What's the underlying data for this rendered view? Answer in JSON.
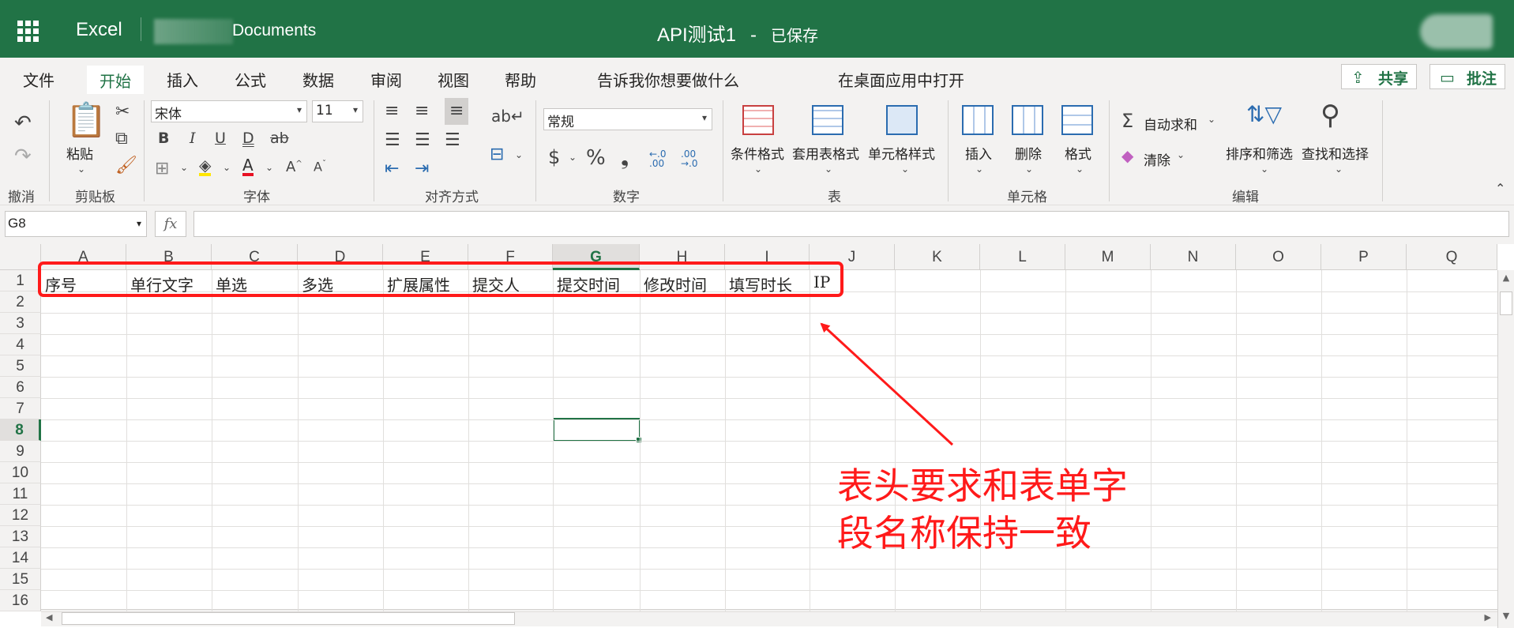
{
  "titlebar": {
    "app_name": "Excel",
    "breadcrumb": "Documents",
    "doc_title": "API测试1",
    "separator": "-",
    "save_status": "已保存"
  },
  "ribbon_tabs": [
    {
      "label": "文件",
      "active": false
    },
    {
      "label": "开始",
      "active": true
    },
    {
      "label": "插入",
      "active": false
    },
    {
      "label": "公式",
      "active": false
    },
    {
      "label": "数据",
      "active": false
    },
    {
      "label": "审阅",
      "active": false
    },
    {
      "label": "视图",
      "active": false
    },
    {
      "label": "帮助",
      "active": false
    },
    {
      "label": "告诉我你想要做什么",
      "active": false
    },
    {
      "label": "在桌面应用中打开",
      "active": false
    }
  ],
  "share_label": "共享",
  "comment_label": "批注",
  "ribbon": {
    "undo_group": "撤消",
    "clipboard": {
      "paste": "粘贴",
      "group": "剪贴板"
    },
    "font": {
      "name": "宋体",
      "size": "11",
      "group": "字体",
      "bold": "B",
      "italic": "I",
      "underline": "U",
      "double_underline": "D",
      "strike": "ab",
      "grow": "A",
      "shrink": "A"
    },
    "alignment": {
      "group": "对齐方式"
    },
    "number": {
      "format": "常规",
      "group": "数字",
      "currency": "$",
      "percent": "%",
      "comma": "❟",
      "inc_decimal": "←.0 .00",
      "dec_decimal": ".00 →.0"
    },
    "styles": {
      "conditional": "条件格式",
      "table_format": "套用表格式",
      "cell_styles": "单元格样式",
      "group": "表"
    },
    "cells": {
      "insert": "插入",
      "delete": "删除",
      "format": "格式",
      "group": "单元格"
    },
    "editing": {
      "autosum": "自动求和",
      "clear": "清除",
      "sort_filter": "排序和筛选",
      "find_select": "查找和选择",
      "group": "编辑"
    }
  },
  "formula_bar": {
    "name_box": "G8",
    "fx": "fx",
    "value": ""
  },
  "sheet": {
    "columns": [
      "A",
      "B",
      "C",
      "D",
      "E",
      "F",
      "G",
      "H",
      "I",
      "J",
      "K",
      "L",
      "M",
      "N",
      "O",
      "P",
      "Q"
    ],
    "rows": [
      "1",
      "2",
      "3",
      "4",
      "5",
      "6",
      "7",
      "8",
      "9",
      "10",
      "11",
      "12",
      "13",
      "14",
      "15",
      "16"
    ],
    "selected_column": "G",
    "selected_row": "8",
    "row1": [
      "序号",
      "单行文字",
      "单选",
      "多选",
      "扩展属性",
      "提交人",
      "提交时间",
      "修改时间",
      "填写时长",
      "IP"
    ]
  },
  "annotation": {
    "text_line1": "表头要求和表单字",
    "text_line2": "段名称保持一致",
    "color": "#ff1a1a"
  },
  "colors": {
    "brand": "#217346",
    "ribbon_bg": "#f3f2f1"
  }
}
